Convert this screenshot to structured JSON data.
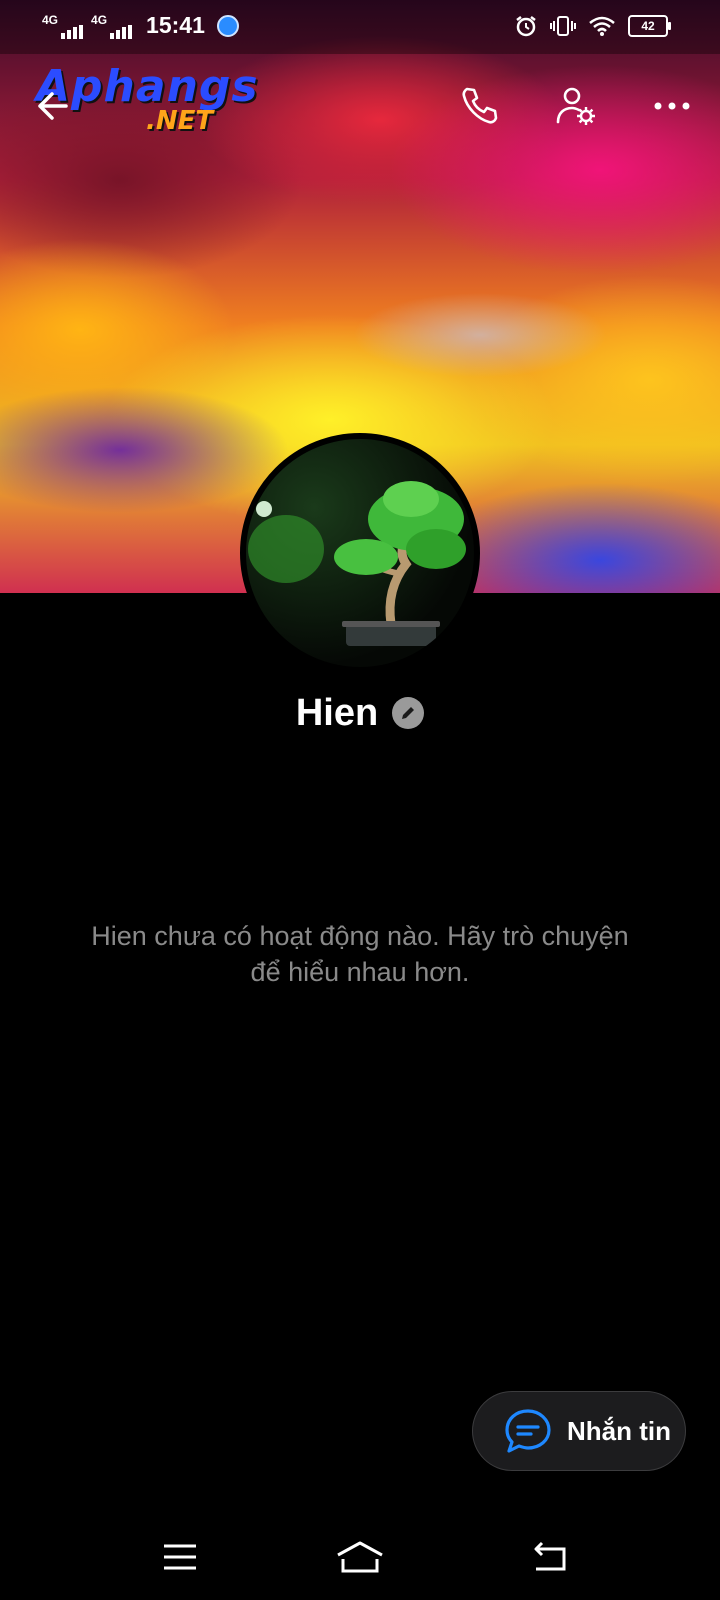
{
  "status_bar": {
    "network_1": "4G",
    "network_2": "4G",
    "time": "15:41",
    "battery": "42",
    "icons": [
      "signal-icon",
      "signal-icon",
      "location-icon",
      "alarm-icon",
      "vibrate-icon",
      "wifi-icon",
      "battery-icon"
    ]
  },
  "watermark": {
    "text_main": "Aphangs",
    "text_sub": ".NET"
  },
  "header": {
    "icons": [
      "back-arrow-icon",
      "phone-icon",
      "person-settings-icon",
      "more-icon"
    ]
  },
  "profile": {
    "name": "Hien",
    "avatar_icon": "bonsai-tree-image",
    "edit_icon": "pencil-icon"
  },
  "activity": {
    "empty_message": "Hien chưa có hoạt động nào. Hãy trò chuyện để hiểu nhau hơn."
  },
  "fab": {
    "label": "Nhắn tin",
    "icon": "chat-bubble-icon"
  },
  "nav_bar": {
    "icons": [
      "menu-icon",
      "home-icon",
      "back-icon"
    ]
  },
  "colors": {
    "background": "#000000",
    "fab_background": "#1c1c1e",
    "accent_blue": "#1e88ff",
    "muted_text": "#8a8a8a"
  }
}
